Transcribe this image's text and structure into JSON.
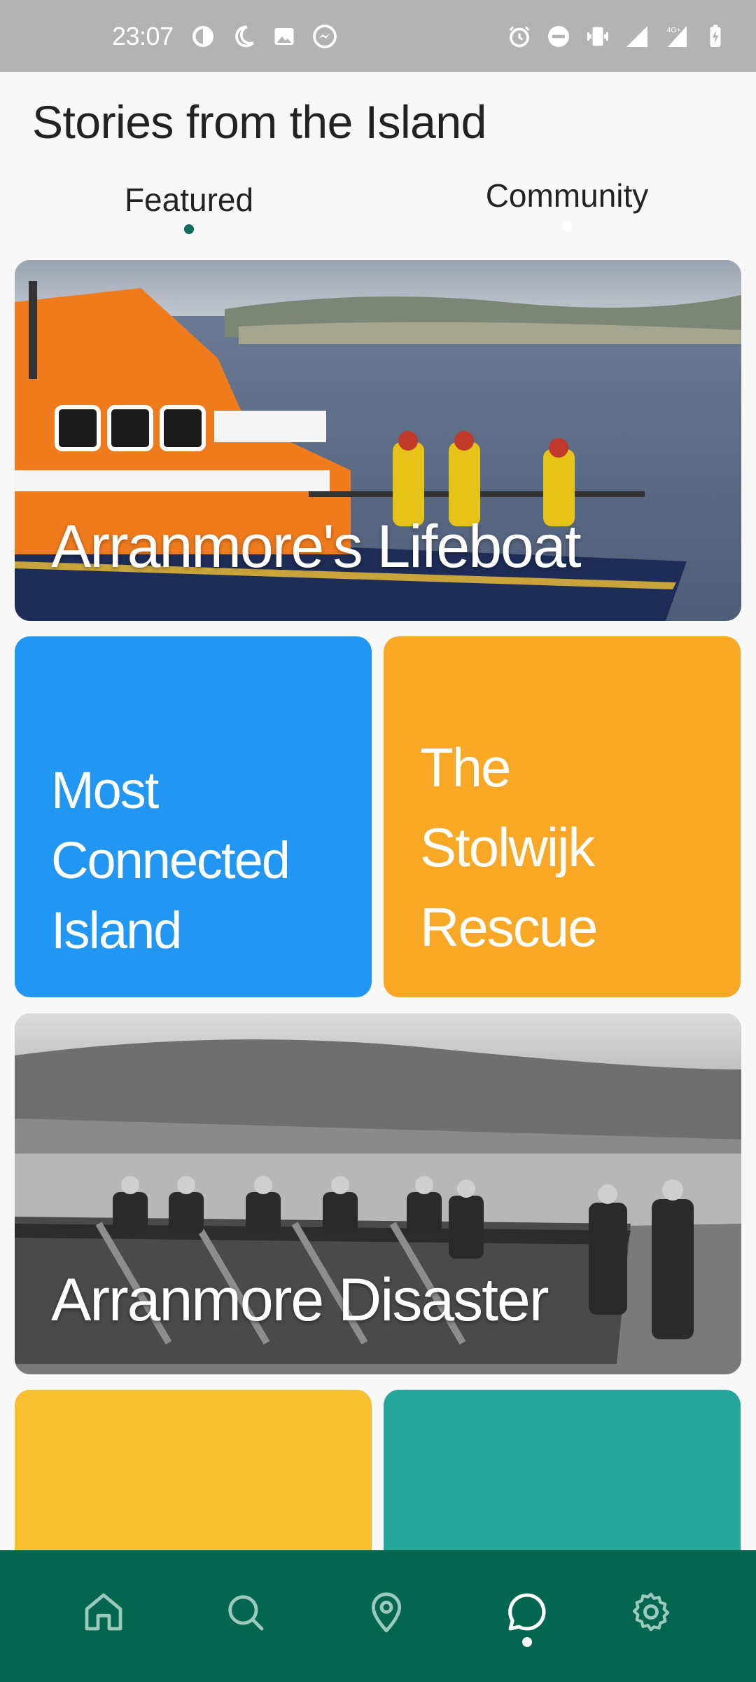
{
  "status_bar": {
    "time": "23:07",
    "left_icons": [
      "data-saver-icon",
      "do-not-disturb-moon-icon",
      "image-icon",
      "messenger-icon"
    ],
    "right_icons": [
      "alarm-icon",
      "minus-circle-icon",
      "vibrate-icon",
      "signal-roaming-icon",
      "signal-4g-icon",
      "battery-charging-icon"
    ],
    "network_label": "4G+"
  },
  "header": {
    "title": "Stories from the Island"
  },
  "tabs": [
    {
      "label": "Featured",
      "active": true
    },
    {
      "label": "Community",
      "active": false
    }
  ],
  "cards": [
    {
      "title": "Arranmore's Lifeboat",
      "kind": "photo",
      "image": "orange lifeboat with crew in yellow gear"
    },
    {
      "title_lines": [
        "Most",
        "Connected",
        "Island"
      ],
      "kind": "color",
      "color": "#2196f3"
    },
    {
      "title_lines": [
        "The",
        "Stolwijk",
        "Rescue"
      ],
      "kind": "color",
      "color": "#f9a825"
    },
    {
      "title": "Arranmore Disaster",
      "kind": "photo",
      "image": "black and white photo of men with a wooden boat on a beach"
    },
    {
      "kind": "color",
      "color": "#f6c030"
    },
    {
      "kind": "color",
      "color": "#26a69a"
    }
  ],
  "colors": {
    "nav_background": "#03664f",
    "tab_indicator": "#0f6e5e",
    "status_bar": "#b3b3b3"
  },
  "bottom_nav": [
    {
      "icon": "home-icon",
      "active": false
    },
    {
      "icon": "search-icon",
      "active": false
    },
    {
      "icon": "location-pin-icon",
      "active": false
    },
    {
      "icon": "chat-bubble-icon",
      "active": true
    },
    {
      "icon": "settings-gear-icon",
      "active": false
    }
  ]
}
